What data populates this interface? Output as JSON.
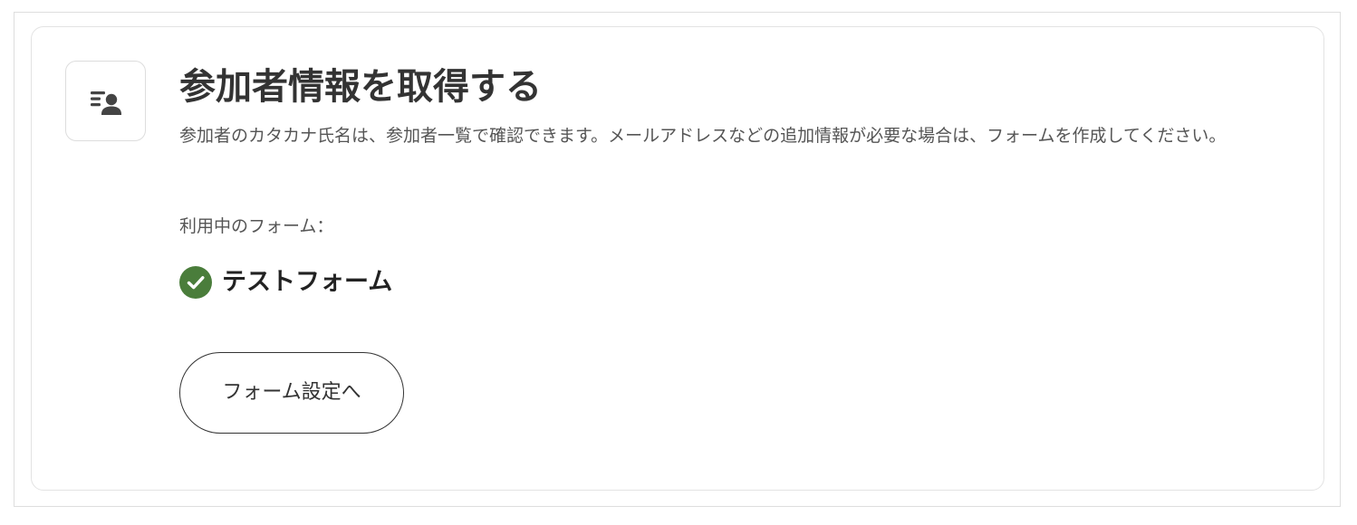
{
  "section": {
    "icon": "participant-list-icon",
    "title": "参加者情報を取得する",
    "description": "参加者のカタカナ氏名は、参加者一覧で確認できます。メールアドレスなどの追加情報が必要な場合は、フォームを作成してください。",
    "current_form_label": "利用中のフォーム：",
    "current_form": {
      "status_icon": "check-circle-icon",
      "status_color": "#4a7d3b",
      "name": "テストフォーム"
    },
    "settings_button_label": "フォーム設定へ"
  },
  "colors": {
    "text_primary": "#333333",
    "text_secondary": "#555555",
    "border": "#dedede",
    "success": "#4a7d3b"
  }
}
